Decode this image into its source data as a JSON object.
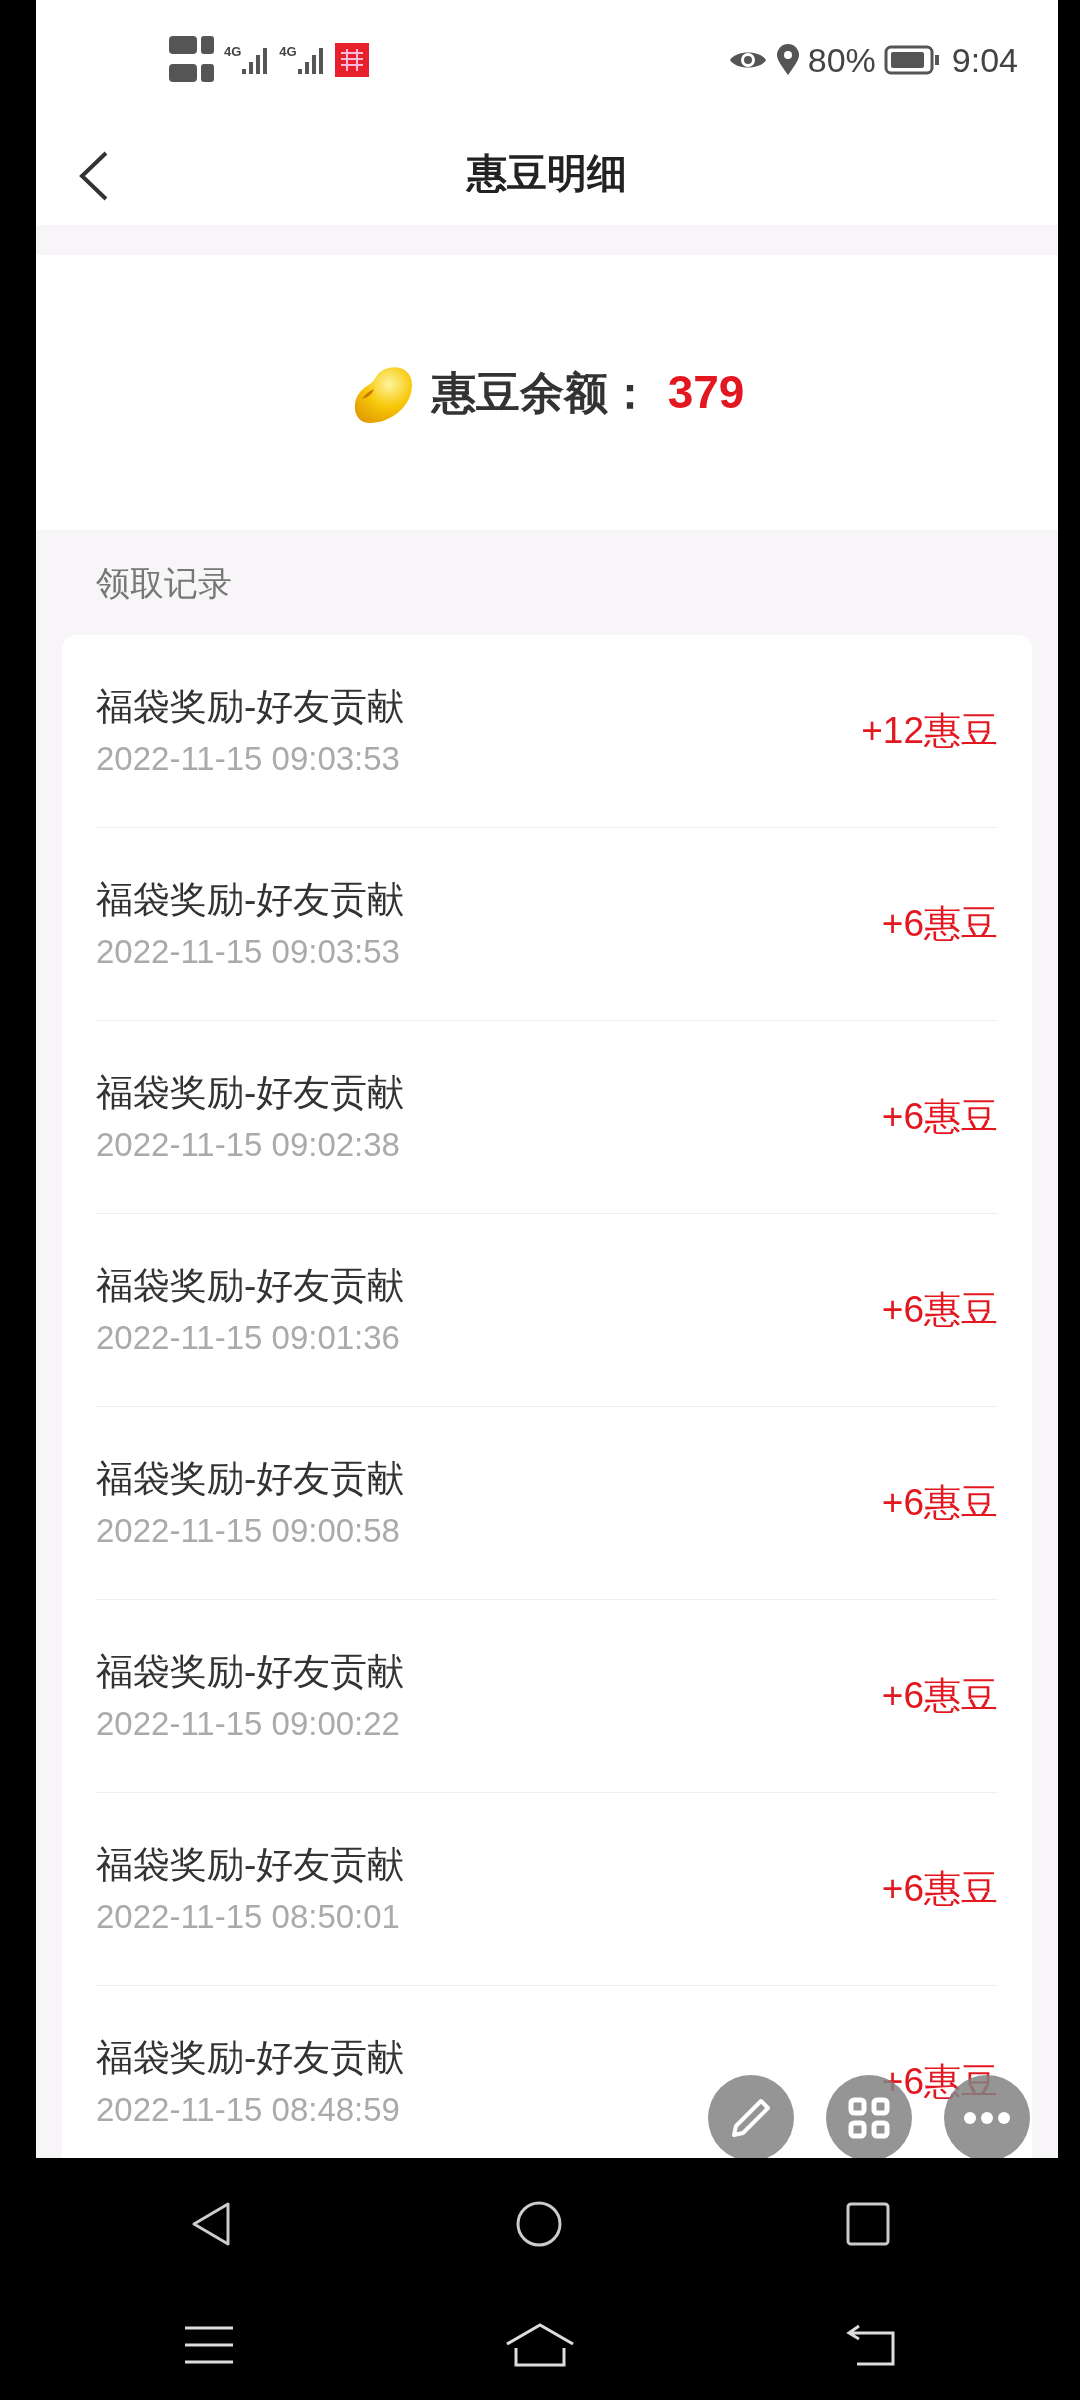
{
  "status_bar": {
    "networks": [
      "4G",
      "4G"
    ],
    "battery": "80%",
    "time": "9:04"
  },
  "header": {
    "title": "惠豆明细"
  },
  "balance": {
    "label": "惠豆余额：",
    "value": "379"
  },
  "records": {
    "heading": "领取记录",
    "items": [
      {
        "title": "福袋奖励-好友贡献",
        "time": "2022-11-15 09:03:53",
        "amount": "+12惠豆"
      },
      {
        "title": "福袋奖励-好友贡献",
        "time": "2022-11-15 09:03:53",
        "amount": "+6惠豆"
      },
      {
        "title": "福袋奖励-好友贡献",
        "time": "2022-11-15 09:02:38",
        "amount": "+6惠豆"
      },
      {
        "title": "福袋奖励-好友贡献",
        "time": "2022-11-15 09:01:36",
        "amount": "+6惠豆"
      },
      {
        "title": "福袋奖励-好友贡献",
        "time": "2022-11-15 09:00:58",
        "amount": "+6惠豆"
      },
      {
        "title": "福袋奖励-好友贡献",
        "time": "2022-11-15 09:00:22",
        "amount": "+6惠豆"
      },
      {
        "title": "福袋奖励-好友贡献",
        "time": "2022-11-15 08:50:01",
        "amount": "+6惠豆"
      },
      {
        "title": "福袋奖励-好友贡献",
        "time": "2022-11-15 08:48:59",
        "amount": "+6惠豆"
      }
    ]
  }
}
